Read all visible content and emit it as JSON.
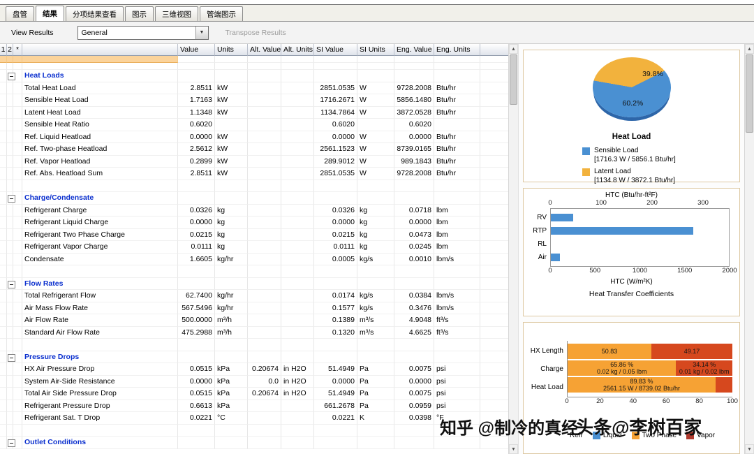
{
  "tabs": [
    {
      "key": "tab-coil",
      "label": "盘管",
      "active": false
    },
    {
      "key": "tab-results",
      "label": "结果",
      "active": true
    },
    {
      "key": "tab-itemized-results",
      "label": "分项结果查看",
      "active": false
    },
    {
      "key": "tab-diagram",
      "label": "图示",
      "active": false
    },
    {
      "key": "tab-3d-view",
      "label": "三维视图",
      "active": false
    },
    {
      "key": "tab-tube-end-diagram",
      "label": "管端图示",
      "active": false
    }
  ],
  "toolbar": {
    "view_results_label": "View Results",
    "results_type_value": "General",
    "transpose_label": "Transpose Results",
    "dropdown_arrow": "▼"
  },
  "table": {
    "columns": [
      "1",
      "2",
      "*",
      "",
      "Value",
      "Units",
      "Alt. Value",
      "Alt. Units",
      "SI Value",
      "SI Units",
      "Eng. Value",
      "Eng. Units"
    ],
    "rows": [
      {
        "t": "sel"
      },
      {
        "t": "b10"
      },
      {
        "t": "group",
        "label": "Heat Loads"
      },
      {
        "t": "data",
        "label": "Total Heat Load",
        "v": "2.8511",
        "u": "kW",
        "sv": "2851.0535",
        "su": "W",
        "ev": "9728.2008",
        "eu": "Btu/hr"
      },
      {
        "t": "data",
        "label": "Sensible Heat Load",
        "v": "1.7163",
        "u": "kW",
        "sv": "1716.2671",
        "su": "W",
        "ev": "5856.1480",
        "eu": "Btu/hr"
      },
      {
        "t": "data",
        "label": "Latent Heat Load",
        "v": "1.1348",
        "u": "kW",
        "sv": "1134.7864",
        "su": "W",
        "ev": "3872.0528",
        "eu": "Btu/hr"
      },
      {
        "t": "data",
        "label": "Sensible Heat Ratio",
        "v": "0.6020",
        "u": "",
        "sv": "0.6020",
        "su": "",
        "ev": "0.6020",
        "eu": ""
      },
      {
        "t": "data",
        "label": "Ref. Liquid Heatload",
        "v": "0.0000",
        "u": "kW",
        "sv": "0.0000",
        "su": "W",
        "ev": "0.0000",
        "eu": "Btu/hr"
      },
      {
        "t": "data",
        "label": "Ref. Two-phase Heatload",
        "v": "2.5612",
        "u": "kW",
        "sv": "2561.1523",
        "su": "W",
        "ev": "8739.0165",
        "eu": "Btu/hr"
      },
      {
        "t": "data",
        "label": "Ref. Vapor Heatload",
        "v": "0.2899",
        "u": "kW",
        "sv": "289.9012",
        "su": "W",
        "ev": "989.1843",
        "eu": "Btu/hr"
      },
      {
        "t": "data",
        "label": "Ref. Abs. Heatload Sum",
        "v": "2.8511",
        "u": "kW",
        "sv": "2851.0535",
        "su": "W",
        "ev": "9728.2008",
        "eu": "Btu/hr"
      },
      {
        "t": "gap"
      },
      {
        "t": "group",
        "label": "Charge/Condensate"
      },
      {
        "t": "data",
        "label": "Refrigerant Charge",
        "v": "0.0326",
        "u": "kg",
        "sv": "0.0326",
        "su": "kg",
        "ev": "0.0718",
        "eu": "lbm"
      },
      {
        "t": "data",
        "label": "Refrigerant Liquid Charge",
        "v": "0.0000",
        "u": "kg",
        "sv": "0.0000",
        "su": "kg",
        "ev": "0.0000",
        "eu": "lbm"
      },
      {
        "t": "data",
        "label": "Refrigerant Two Phase Charge",
        "v": "0.0215",
        "u": "kg",
        "sv": "0.0215",
        "su": "kg",
        "ev": "0.0473",
        "eu": "lbm"
      },
      {
        "t": "data",
        "label": "Refrigerant Vapor Charge",
        "v": "0.0111",
        "u": "kg",
        "sv": "0.0111",
        "su": "kg",
        "ev": "0.0245",
        "eu": "lbm"
      },
      {
        "t": "data",
        "label": "Condensate",
        "v": "1.6605",
        "u": "kg/hr",
        "sv": "0.0005",
        "su": "kg/s",
        "ev": "0.0010",
        "eu": "lbm/s"
      },
      {
        "t": "gap"
      },
      {
        "t": "group",
        "label": "Flow Rates"
      },
      {
        "t": "data",
        "label": "Total Refrigerant Flow",
        "v": "62.7400",
        "u": "kg/hr",
        "sv": "0.0174",
        "su": "kg/s",
        "ev": "0.0384",
        "eu": "lbm/s"
      },
      {
        "t": "data",
        "label": "Air Mass Flow Rate",
        "v": "567.5496",
        "u": "kg/hr",
        "sv": "0.1577",
        "su": "kg/s",
        "ev": "0.3476",
        "eu": "lbm/s"
      },
      {
        "t": "data",
        "label": "Air Flow Rate",
        "v": "500.0000",
        "u": "m³/h",
        "sv": "0.1389",
        "su": "m³/s",
        "ev": "4.9048",
        "eu": "ft³/s"
      },
      {
        "t": "data",
        "label": "Standard Air Flow Rate",
        "v": "475.2988",
        "u": "m³/h",
        "sv": "0.1320",
        "su": "m³/s",
        "ev": "4.6625",
        "eu": "ft³/s"
      },
      {
        "t": "gap"
      },
      {
        "t": "group",
        "label": "Pressure Drops"
      },
      {
        "t": "data",
        "label": "HX Air Pressure Drop",
        "v": "0.0515",
        "u": "kPa",
        "av": "0.20674",
        "au": "in H2O",
        "sv": "51.4949",
        "su": "Pa",
        "ev": "0.0075",
        "eu": "psi"
      },
      {
        "t": "data",
        "label": "System Air-Side Resistance",
        "v": "0.0000",
        "u": "kPa",
        "av": "0.0",
        "au": "in H2O",
        "sv": "0.0000",
        "su": "Pa",
        "ev": "0.0000",
        "eu": "psi"
      },
      {
        "t": "data",
        "label": "Total Air Side Pressure Drop",
        "v": "0.0515",
        "u": "kPa",
        "av": "0.20674",
        "au": "in H2O",
        "sv": "51.4949",
        "su": "Pa",
        "ev": "0.0075",
        "eu": "psi"
      },
      {
        "t": "data",
        "label": "Refrigerant Pressure Drop",
        "v": "0.6613",
        "u": "kPa",
        "sv": "661.2678",
        "su": "Pa",
        "ev": "0.0959",
        "eu": "psi"
      },
      {
        "t": "data",
        "label": "Refrigerant Sat. T Drop",
        "v": "0.0221",
        "u": "°C",
        "sv": "0.0221",
        "su": "K",
        "ev": "0.0398",
        "eu": "°F"
      },
      {
        "t": "gap"
      },
      {
        "t": "group",
        "label": "Outlet Conditions"
      }
    ]
  },
  "charts": {
    "palette": {
      "blue": "#4a90d2",
      "pieOrange": "#f2b23d",
      "barOrange": "#f6a234",
      "barRed": "#d6481e",
      "legendVapor": "#b03a2e"
    },
    "pie": {
      "title": "Heat Load",
      "slices": [
        {
          "label": "39.8%",
          "pct": 39.8,
          "color": "pieOrange"
        },
        {
          "label": "60.2%",
          "pct": 60.2,
          "color": "blue"
        }
      ],
      "legend": [
        {
          "color": "blue",
          "name": "Sensible Load",
          "value": "[1716.3 W / 5856.1 Btu/hr]"
        },
        {
          "color": "pieOrange",
          "name": "Latent Load",
          "value": "[1134.8 W / 3872.1 Btu/hr]"
        }
      ]
    },
    "htc": {
      "title": "Heat Transfer Coefficients",
      "top_axis": {
        "label": "HTC (Btu/hr-ft²F)",
        "ticks": [
          0,
          100,
          200,
          300
        ],
        "max": 352
      },
      "bottom_axis": {
        "label": "HTC (W/m²K)",
        "ticks": [
          0,
          500,
          1000,
          1500,
          2000
        ],
        "max": 2000
      },
      "categories": [
        "RV",
        "RTP",
        "RL",
        "Air"
      ],
      "values": [
        250,
        1600,
        0,
        100
      ],
      "bar_color": "blue"
    },
    "stack": {
      "categories": [
        "HX Length",
        "Charge",
        "Heat Load"
      ],
      "rows": [
        [
          {
            "pct": 50.83,
            "color": "barOrange",
            "lines": [
              "50.83"
            ]
          },
          {
            "pct": 49.17,
            "color": "barRed",
            "lines": [
              "49.17"
            ]
          }
        ],
        [
          {
            "pct": 65.86,
            "color": "barOrange",
            "lines": [
              "65.86 %",
              "0.02 kg / 0.05 lbm"
            ]
          },
          {
            "pct": 34.14,
            "color": "barRed",
            "lines": [
              "34.14 %",
              "0.01 kg / 0.02 lbm"
            ]
          }
        ],
        [
          {
            "pct": 89.83,
            "color": "barOrange",
            "lines": [
              "89.83 %",
              "2561.15 W / 8739.02 Btu/hr"
            ]
          },
          {
            "pct": 10.17,
            "color": "barRed",
            "lines": []
          }
        ]
      ],
      "axis_ticks": [
        0,
        20,
        40,
        60,
        80,
        100
      ],
      "legend_prefix": "Refr",
      "legend": [
        {
          "color": "blue",
          "name": "Liquid"
        },
        {
          "color": "barOrange",
          "name": "Two Phase"
        },
        {
          "color": "legendVapor",
          "name": "Vapor"
        }
      ]
    }
  },
  "watermark": {
    "left": "知乎 @制冷的真经",
    "right": "头条@李树百家"
  }
}
